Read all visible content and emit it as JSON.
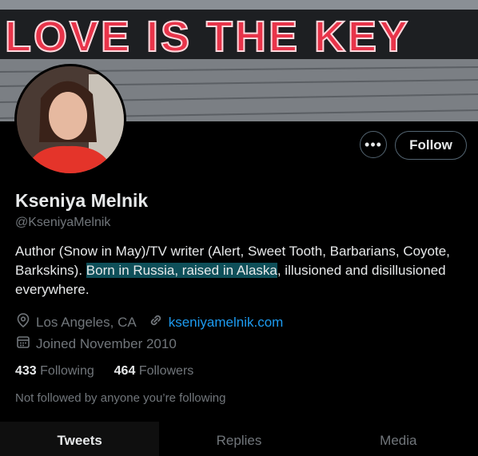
{
  "banner": {
    "graffiti_text": "LOVE IS THE KEY"
  },
  "profile": {
    "name": "Kseniya Melnik",
    "handle": "@KseniyaMelnik",
    "bio_before": "Author (Snow in May)/TV writer (Alert, Sweet Tooth, Barbarians, Coyote, Barkskins). ",
    "bio_highlight": "Born in Russia, raised in Alaska",
    "bio_after": ", illusioned and disillusioned everywhere.",
    "location": "Los Angeles, CA",
    "website": "kseniyamelnik.com",
    "joined": "Joined November 2010"
  },
  "actions": {
    "more_label": "•••",
    "follow_label": "Follow"
  },
  "stats": {
    "following_count": "433",
    "following_label": "Following",
    "followers_count": "464",
    "followers_label": "Followers"
  },
  "note": "Not followed by anyone you’re following",
  "tabs": [
    {
      "label": "Tweets",
      "active": true
    },
    {
      "label": "Replies",
      "active": false
    },
    {
      "label": "Media",
      "active": false
    }
  ],
  "icons": [
    "location-pin-icon",
    "link-icon",
    "calendar-icon",
    "more-dots-icon"
  ],
  "colors": {
    "accent": "#1d9bf0",
    "highlight": "#0e4f59",
    "muted": "#71767b"
  }
}
